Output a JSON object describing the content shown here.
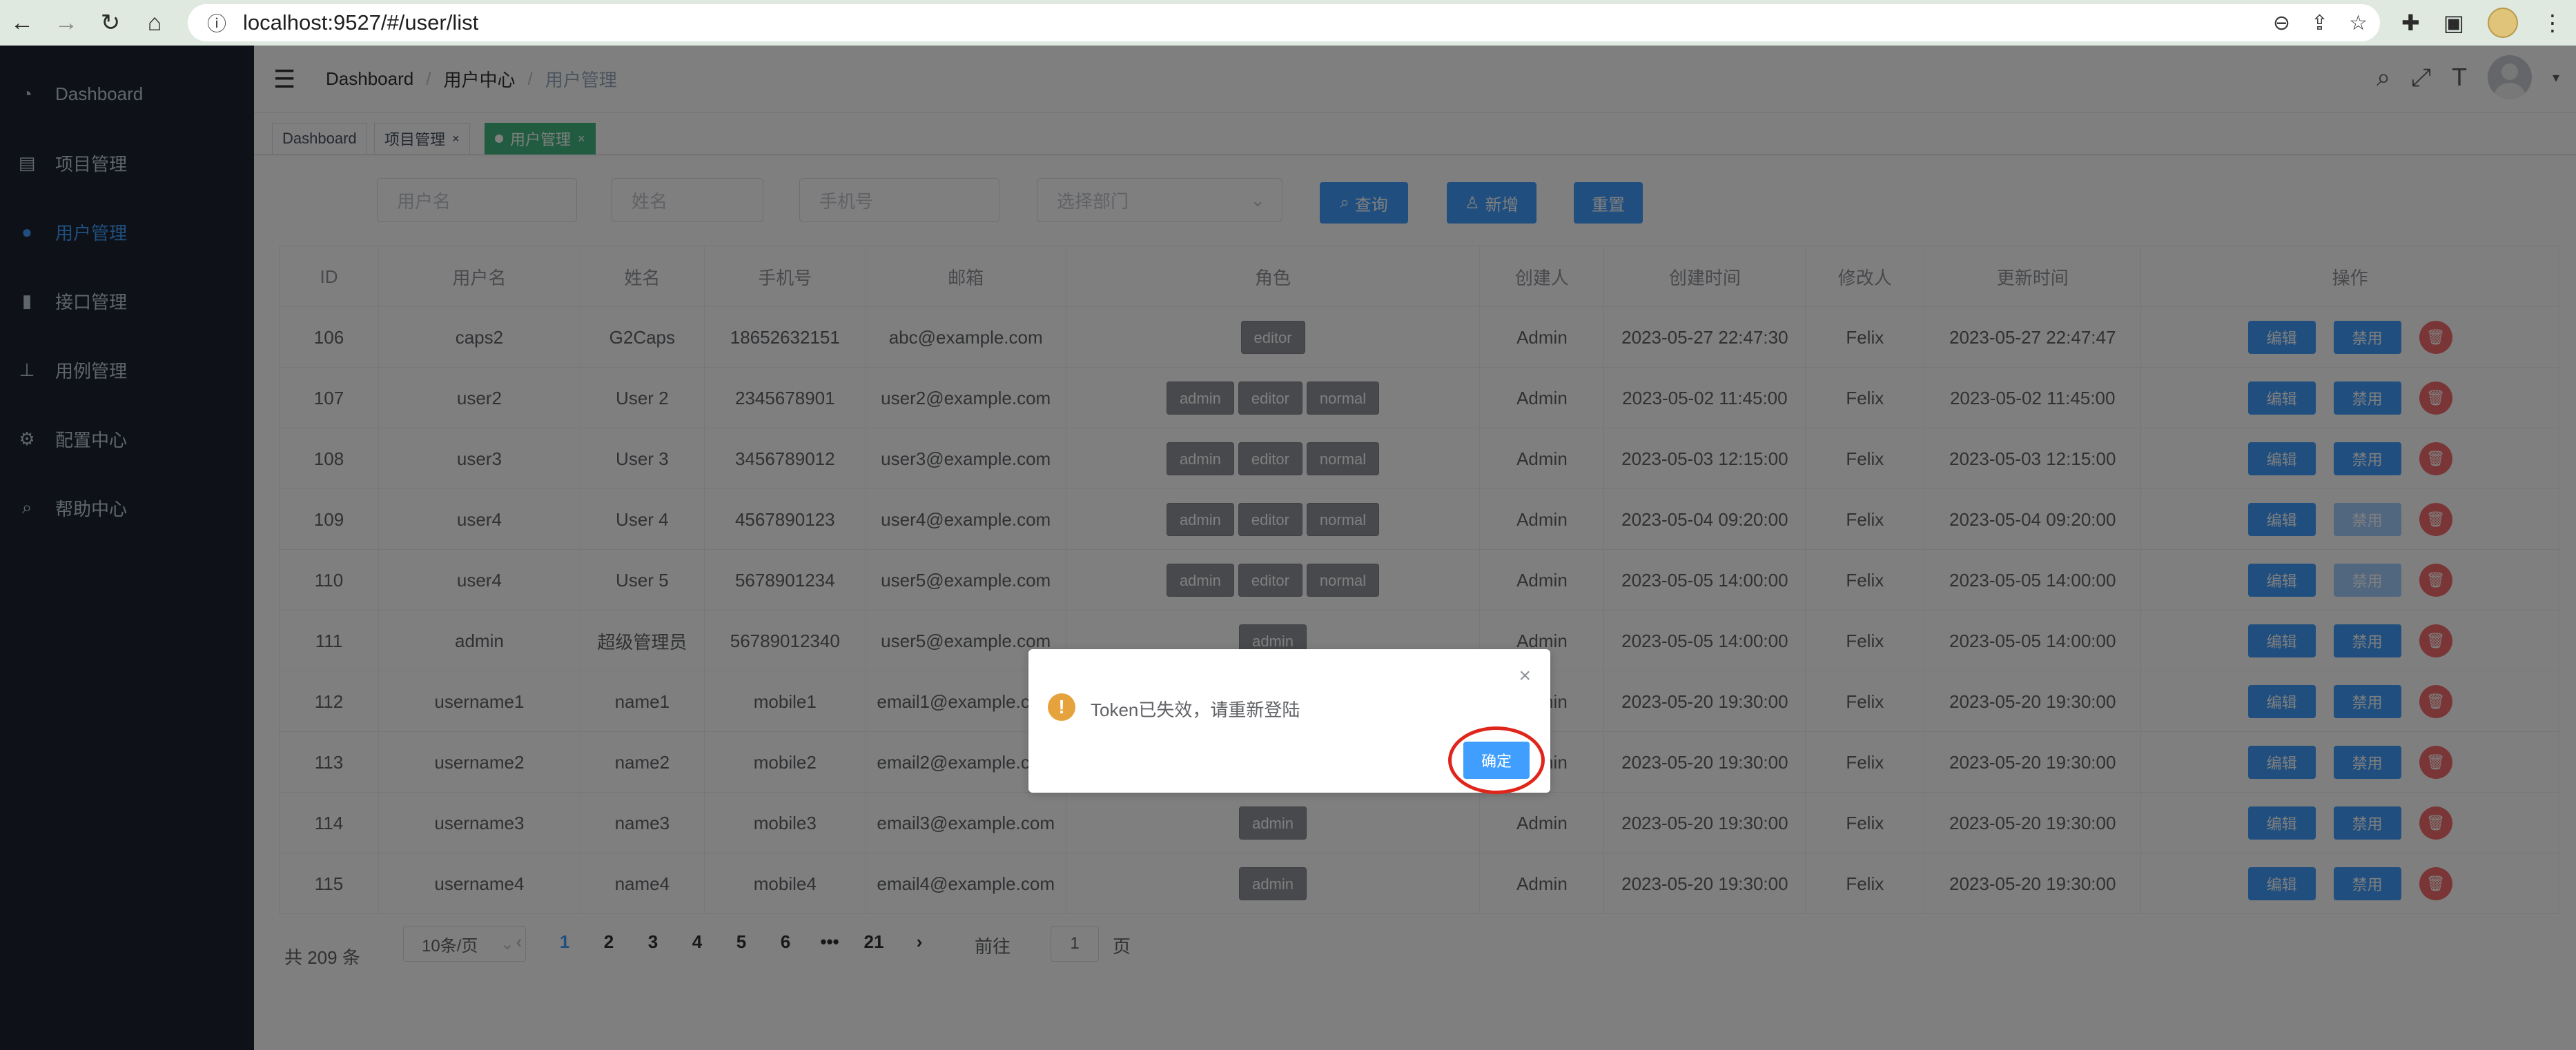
{
  "browser": {
    "url": "localhost:9527/#/user/list",
    "back_icon": "back-arrow-icon",
    "forward_icon": "forward-arrow-icon",
    "reload_icon": "reload-icon",
    "home_icon": "home-icon"
  },
  "sidebar": {
    "items": [
      {
        "label": "Dashboard",
        "icon": "dashboard-icon",
        "active": false
      },
      {
        "label": "项目管理",
        "icon": "book-icon",
        "active": false
      },
      {
        "label": "用户管理",
        "icon": "user-icon",
        "active": true
      },
      {
        "label": "接口管理",
        "icon": "interface-icon",
        "active": false
      },
      {
        "label": "用例管理",
        "icon": "tree-icon",
        "active": false
      },
      {
        "label": "配置中心",
        "icon": "settings-icon",
        "active": false
      },
      {
        "label": "帮助中心",
        "icon": "search-icon",
        "active": false
      }
    ]
  },
  "navbar": {
    "breadcrumb": [
      "Dashboard",
      "用户中心",
      "用户管理"
    ]
  },
  "tags": [
    {
      "label": "Dashboard"
    },
    {
      "label": "项目管理"
    },
    {
      "label": "用户管理"
    }
  ],
  "filters": {
    "username_placeholder": "用户名",
    "name_placeholder": "姓名",
    "phone_placeholder": "手机号",
    "dept_placeholder": "选择部门",
    "search_label": "查询",
    "add_label": "新增",
    "reset_label": "重置"
  },
  "table": {
    "headers": [
      "ID",
      "用户名",
      "姓名",
      "手机号",
      "邮箱",
      "角色",
      "创建人",
      "创建时间",
      "修改人",
      "更新时间",
      "操作"
    ],
    "edit_label": "编辑",
    "disable_label": "禁用",
    "rows": [
      {
        "id": "106",
        "username": "caps2",
        "name": "G2Caps",
        "phone": "18652632151",
        "email": "abc@example.com",
        "roles": [
          "editor"
        ],
        "creator": "Admin",
        "created": "2023-05-27 22:47:30",
        "modifier": "Felix",
        "updated": "2023-05-27 22:47:47",
        "disable_enabled": true
      },
      {
        "id": "107",
        "username": "user2",
        "name": "User 2",
        "phone": "2345678901",
        "email": "user2@example.com",
        "roles": [
          "admin",
          "editor",
          "normal"
        ],
        "creator": "Admin",
        "created": "2023-05-02 11:45:00",
        "modifier": "Felix",
        "updated": "2023-05-02 11:45:00",
        "disable_enabled": true
      },
      {
        "id": "108",
        "username": "user3",
        "name": "User 3",
        "phone": "3456789012",
        "email": "user3@example.com",
        "roles": [
          "admin",
          "editor",
          "normal"
        ],
        "creator": "Admin",
        "created": "2023-05-03 12:15:00",
        "modifier": "Felix",
        "updated": "2023-05-03 12:15:00",
        "disable_enabled": true
      },
      {
        "id": "109",
        "username": "user4",
        "name": "User 4",
        "phone": "4567890123",
        "email": "user4@example.com",
        "roles": [
          "admin",
          "editor",
          "normal"
        ],
        "creator": "Admin",
        "created": "2023-05-04 09:20:00",
        "modifier": "Felix",
        "updated": "2023-05-04 09:20:00",
        "disable_enabled": false
      },
      {
        "id": "110",
        "username": "user4",
        "name": "User 5",
        "phone": "5678901234",
        "email": "user5@example.com",
        "roles": [
          "admin",
          "editor",
          "normal"
        ],
        "creator": "Admin",
        "created": "2023-05-05 14:00:00",
        "modifier": "Felix",
        "updated": "2023-05-05 14:00:00",
        "disable_enabled": false
      },
      {
        "id": "111",
        "username": "admin",
        "name": "超级管理员",
        "phone": "56789012340",
        "email": "user5@example.com",
        "roles": [
          "admin"
        ],
        "creator": "Admin",
        "created": "2023-05-05 14:00:00",
        "modifier": "Felix",
        "updated": "2023-05-05 14:00:00",
        "disable_enabled": true
      },
      {
        "id": "112",
        "username": "username1",
        "name": "name1",
        "phone": "mobile1",
        "email": "email1@example.com",
        "roles": [],
        "creator": "Admin",
        "created": "2023-05-20 19:30:00",
        "modifier": "Felix",
        "updated": "2023-05-20 19:30:00",
        "disable_enabled": true
      },
      {
        "id": "113",
        "username": "username2",
        "name": "name2",
        "phone": "mobile2",
        "email": "email2@example.com",
        "roles": [],
        "creator": "Admin",
        "created": "2023-05-20 19:30:00",
        "modifier": "Felix",
        "updated": "2023-05-20 19:30:00",
        "disable_enabled": true
      },
      {
        "id": "114",
        "username": "username3",
        "name": "name3",
        "phone": "mobile3",
        "email": "email3@example.com",
        "roles": [
          "admin"
        ],
        "creator": "Admin",
        "created": "2023-05-20 19:30:00",
        "modifier": "Felix",
        "updated": "2023-05-20 19:30:00",
        "disable_enabled": true
      },
      {
        "id": "115",
        "username": "username4",
        "name": "name4",
        "phone": "mobile4",
        "email": "email4@example.com",
        "roles": [
          "admin"
        ],
        "creator": "Admin",
        "created": "2023-05-20 19:30:00",
        "modifier": "Felix",
        "updated": "2023-05-20 19:30:00",
        "disable_enabled": true
      }
    ]
  },
  "pagination": {
    "total_label": "共 209 条",
    "page_size": "10条/页",
    "pages": [
      "1",
      "2",
      "3",
      "4",
      "5",
      "6",
      "•••",
      "21"
    ],
    "current": "1",
    "goto_prefix": "前往",
    "goto_value": "1",
    "goto_suffix": "页"
  },
  "dialog": {
    "message": "Token已失效，请重新登陆",
    "confirm_label": "确定",
    "icon": "warning-icon"
  },
  "colors": {
    "primary": "#409eff",
    "sidebar_bg": "#1d2430",
    "tag_active": "#42b983",
    "danger": "#f56c6c",
    "warning": "#e6a23c",
    "highlight_ring": "#e0251b"
  }
}
